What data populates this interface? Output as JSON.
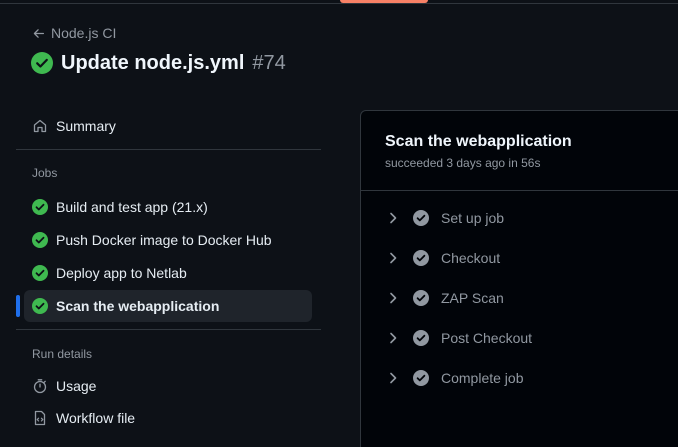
{
  "colors": {
    "background": "#0d1117",
    "success": "#3fb950",
    "accent_underline": "#f78166",
    "selected_indicator": "#1f6feb",
    "muted_text": "#9198a1"
  },
  "header": {
    "back_label": "Node.js CI",
    "title": "Update node.js.yml",
    "run_number": "#74"
  },
  "sidebar": {
    "summary_label": "Summary",
    "jobs_heading": "Jobs",
    "jobs": [
      {
        "label": "Build and test app (21.x)",
        "status": "success"
      },
      {
        "label": "Push Docker image to Docker Hub",
        "status": "success"
      },
      {
        "label": "Deploy app to Netlab",
        "status": "success"
      },
      {
        "label": "Scan the webapplication",
        "status": "success",
        "selected": true
      }
    ],
    "run_details_heading": "Run details",
    "usage_label": "Usage",
    "workflow_file_label": "Workflow file"
  },
  "job_panel": {
    "title": "Scan the webapplication",
    "subtitle": "succeeded 3 days ago in 56s",
    "steps": [
      {
        "label": "Set up job",
        "icon": "check-circle-icon"
      },
      {
        "label": "Checkout",
        "icon": "check-circle-icon"
      },
      {
        "label": "ZAP Scan",
        "icon": "check-circle-icon"
      },
      {
        "label": "Post Checkout",
        "icon": "check-circle-icon"
      },
      {
        "label": "Complete job",
        "icon": "check-circle-icon"
      }
    ]
  }
}
